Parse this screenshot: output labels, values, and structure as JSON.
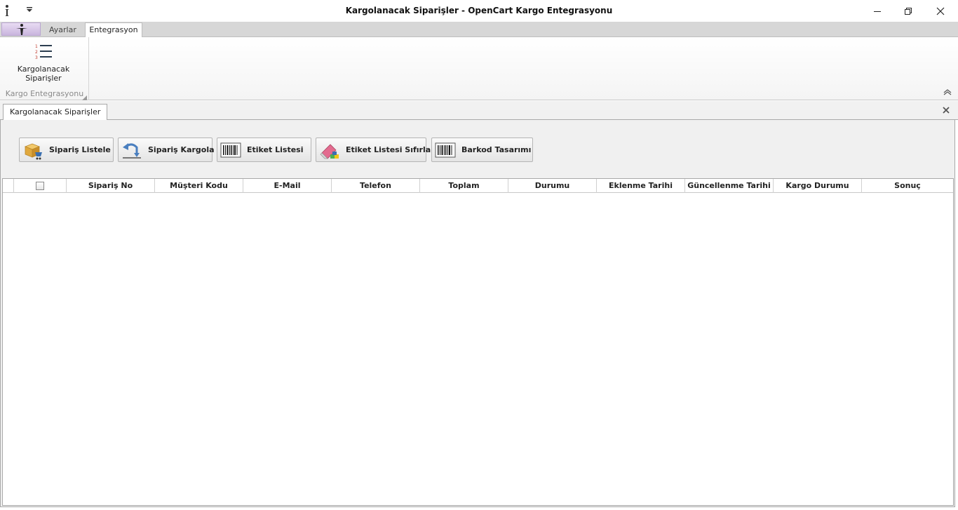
{
  "window": {
    "title": "Kargolanacak Siparişler - OpenCart Kargo Entegrasyonu"
  },
  "ribbon": {
    "tabs": [
      {
        "label": "Ayarlar",
        "active": false
      },
      {
        "label": "Entegrasyon",
        "active": true
      }
    ],
    "groups": [
      {
        "label": "Kargo Entegrasyonu",
        "buttons": [
          {
            "label": "Kargolanacak Siparişler",
            "icon": "numbered-list-icon"
          }
        ]
      }
    ]
  },
  "document_tabs": [
    {
      "label": "Kargolanacak Siparişler",
      "active": true
    }
  ],
  "toolbar": {
    "buttons": [
      {
        "label": "Sipariş Listele",
        "icon": "box-cart-icon"
      },
      {
        "label": "Sipariş Kargola",
        "icon": "return-arrow-icon"
      },
      {
        "label": "Etiket Listesi",
        "icon": "barcode-icon"
      },
      {
        "label": "Etiket Listesi Sıfırla",
        "icon": "eraser-icon"
      },
      {
        "label": "Barkod Tasarımı",
        "icon": "barcode-icon"
      }
    ]
  },
  "grid": {
    "columns": [
      "Sipariş No",
      "Müşteri Kodu",
      "E-Mail",
      "Telefon",
      "Toplam",
      "Durumu",
      "Eklenme Tarihi",
      "Güncellenme Tarihi",
      "Kargo Durumu",
      "Sonuç"
    ],
    "select_all_checked": false,
    "rows": []
  },
  "colors": {
    "ribbon_tabstrip": "#d7d7d7",
    "content_background": "#f0f0f0",
    "border": "#a9a9a9"
  }
}
